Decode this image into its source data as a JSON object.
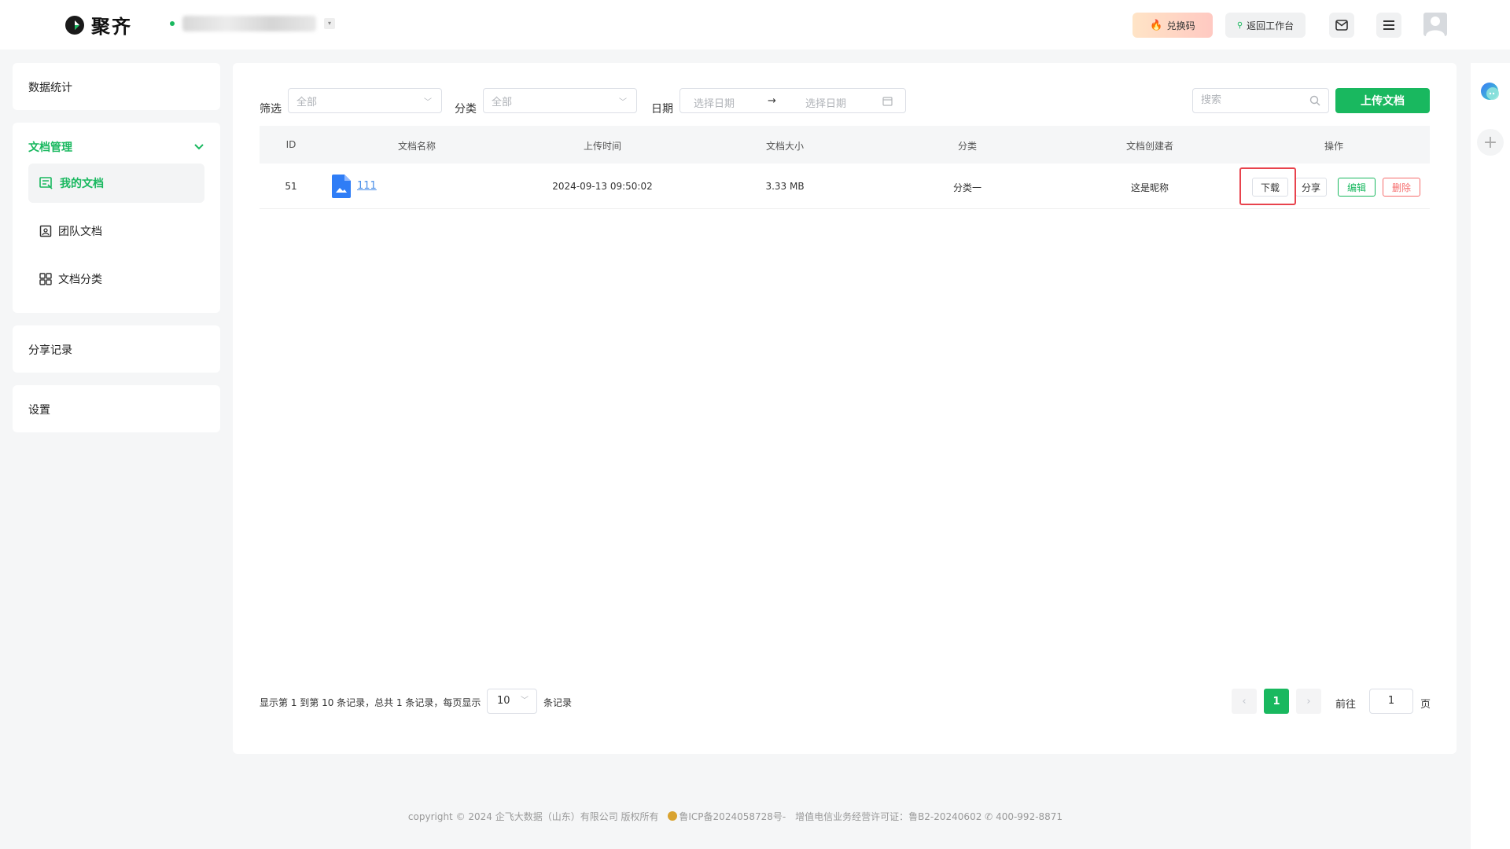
{
  "app": {
    "name": "聚齐"
  },
  "header": {
    "redeem_label": "兑换码",
    "back_label": "返回工作台"
  },
  "sidebar": {
    "stats_label": "数据统计",
    "doc_mgmt_label": "文档管理",
    "my_docs_label": "我的文档",
    "team_docs_label": "团队文档",
    "doc_category_label": "文档分类",
    "share_records_label": "分享记录",
    "settings_label": "设置"
  },
  "filters": {
    "filter_label": "筛选",
    "filter_value": "全部",
    "category_label": "分类",
    "category_value": "全部",
    "date_label": "日期",
    "date_start_placeholder": "选择日期",
    "date_separator": "→",
    "date_end_placeholder": "选择日期",
    "search_placeholder": "搜索",
    "upload_label": "上传文档"
  },
  "table": {
    "columns": [
      "ID",
      "文档名称",
      "上传时间",
      "文档大小",
      "分类",
      "文档创建者",
      "操作"
    ],
    "rows": [
      {
        "id": "51",
        "name": "111",
        "upload_time": "2024-09-13 09:50:02",
        "size": "3.33 MB",
        "category": "分类一",
        "creator": "这是昵称",
        "actions": {
          "download": "下载",
          "share": "分享",
          "edit": "编辑",
          "delete": "删除"
        }
      }
    ]
  },
  "pagination": {
    "summary": "显示第 1 到第 10 条记录，总共 1 条记录，每页显示",
    "page_size": "10",
    "records_suffix": "条记录",
    "prev": "‹",
    "current_page": "1",
    "next": "›",
    "goto_label": "前往",
    "goto_value": "1",
    "page_suffix": "页"
  },
  "footer": {
    "copyright": "copyright © 2024 企飞大数据（山东）有限公司 版权所有",
    "icp": "鲁ICP备2024058728号-",
    "license": "增值电信业务经营许可证：鲁B2-20240602",
    "phone": "400-992-8871"
  },
  "colors": {
    "accent": "#19b85f",
    "danger": "#f56c6c",
    "link": "#4a8fe8",
    "highlight": "#e8434d"
  }
}
